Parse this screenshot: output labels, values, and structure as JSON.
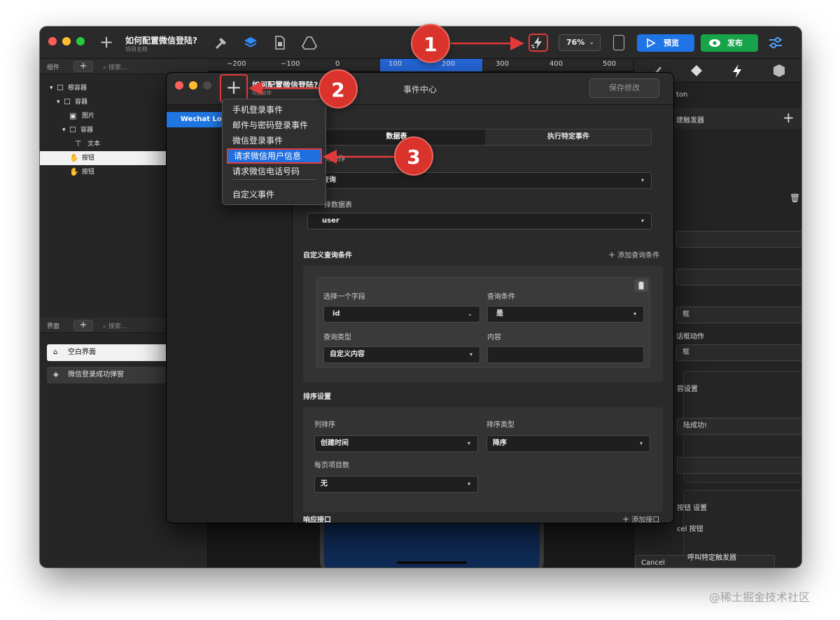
{
  "app": {
    "project_title": "如何配置微信登陆?",
    "project_subtitle": "项目名称",
    "zoom": "76%",
    "preview_label": "预览",
    "publish_label": "发布",
    "colors": {
      "preview": "#1f74e6",
      "publish": "#17a34a",
      "highlight": "#e23a3a",
      "accent": "#1f6fe0"
    }
  },
  "ruler": {
    "ticks": [
      "−200",
      "−100",
      "0",
      "100",
      "200",
      "300",
      "400",
      "500"
    ]
  },
  "components_panel": {
    "label": "组件",
    "search_placeholder": "搜索...",
    "tree": [
      {
        "label": "根容器",
        "icon": "box-icon",
        "expanded": true
      },
      {
        "label": "容器",
        "icon": "box-icon",
        "expanded": true
      },
      {
        "label": "图片",
        "icon": "image-icon"
      },
      {
        "label": "容器",
        "icon": "box-icon",
        "expanded": true
      },
      {
        "label": "文本",
        "icon": "text-icon"
      },
      {
        "label": "按钮",
        "icon": "hand-icon",
        "selected": true
      },
      {
        "label": "按钮",
        "icon": "hand-icon"
      }
    ]
  },
  "pages_panel": {
    "label": "界面",
    "search_placeholder": "搜索...",
    "pages": [
      {
        "label": "空白界面",
        "icon": "home-icon",
        "selected": true
      },
      {
        "label": "微信登录成功弹窗",
        "icon": "layers-icon"
      }
    ]
  },
  "inspector": {
    "title_fragment": "ton",
    "trigger_label": "建触发器",
    "field_1": "框",
    "dialog_action_label": "话框动作",
    "field_2": "框",
    "content_settings": "容设置",
    "login_success_text": "陆成功!",
    "cancel_button_settings": "按钮 设置",
    "cancel_button_label": "cel 按钮",
    "cancel_value": "Cancel",
    "call_trigger_label": "呼叫特定触发器"
  },
  "event_center": {
    "title": "事件中心",
    "project_title": "如何配置微信登陆?",
    "project_subtitle": "项目名称",
    "save_label": "保存修改",
    "events": [
      "Wechat Log"
    ],
    "tabs": [
      "数据表",
      "执行特定事件"
    ],
    "operation_label": "的操作",
    "operation_value": "查询",
    "table_label": "择数据表",
    "table_value": "user",
    "custom_query_label": "自定义查询条件",
    "add_query_label": "添加查询条件",
    "field_label": "选择一个字段",
    "field_value": "id",
    "condition_label": "查询条件",
    "condition_value": "是",
    "query_type_label": "查询类型",
    "query_type_value": "自定义内容",
    "content_label": "内容",
    "content_value": "",
    "sort_settings_label": "排序设置",
    "sort_column_label": "列排序",
    "sort_column_value": "创建时间",
    "sort_type_label": "排序类型",
    "sort_type_value": "降序",
    "per_page_label": "每页项目数",
    "per_page_value": "无",
    "response_label": "响应接口",
    "add_response_label": "添加接口"
  },
  "add_menu": {
    "items": [
      "手机登录事件",
      "邮件与密码登录事件",
      "微信登录事件",
      "请求微信用户信息",
      "请求微信电话号码"
    ],
    "highlighted_index": 3,
    "custom_item": "自定义事件"
  },
  "annotations": {
    "steps": [
      "1",
      "2",
      "3"
    ]
  },
  "watermark": "@稀土掘金技术社区"
}
